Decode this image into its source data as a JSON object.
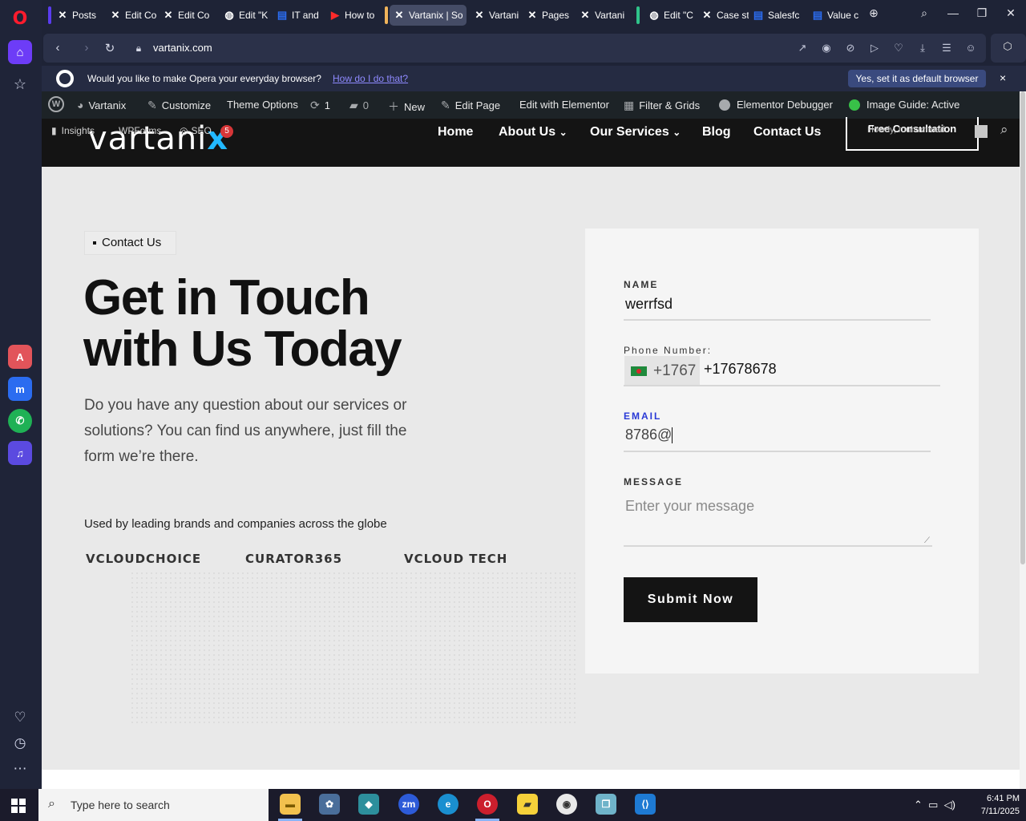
{
  "browser": {
    "url": "vartanix.com",
    "tabs": [
      {
        "label": "Posts",
        "icon": "x-logo"
      },
      {
        "label": "Edit Co",
        "icon": "x-logo"
      },
      {
        "label": "Edit Co",
        "icon": "x-logo"
      },
      {
        "label": "Edit \"K",
        "icon": "globe"
      },
      {
        "label": "IT and",
        "icon": "doc"
      },
      {
        "label": "How to",
        "icon": "youtube"
      },
      {
        "label": "Vartanix | So",
        "icon": "x-logo"
      },
      {
        "label": "Vartani",
        "icon": "x-logo"
      },
      {
        "label": "Pages",
        "icon": "x-logo"
      },
      {
        "label": "Vartani",
        "icon": "x-logo"
      },
      {
        "label": "Edit \"C",
        "icon": "globe"
      },
      {
        "label": "Case st",
        "icon": "x-logo"
      },
      {
        "label": "Salesfc",
        "icon": "doc"
      },
      {
        "label": "Value c",
        "icon": "doc"
      }
    ],
    "default_prompt": {
      "question": "Would you like to make Opera your everyday browser?",
      "link": "How do I do that?",
      "button": "Yes, set it as default browser",
      "close": "×"
    }
  },
  "wp_admin_bar": {
    "site": "Vartanix",
    "customize": "Customize",
    "theme_options": "Theme Options",
    "updates": "1",
    "comments": "0",
    "new": "New",
    "edit_page": "Edit Page",
    "edit_elementor": "Edit with Elementor",
    "filter_grids": "Filter & Grids",
    "elementor_debugger": "Elementor Debugger",
    "image_guide": "Image Guide: Active",
    "insights": "Insights",
    "wpforms": "WPForms",
    "seo": "SEO",
    "seo_badge": "5",
    "howdy": "Howdy, muhammad"
  },
  "site": {
    "logo_text": "vartani",
    "logo_x": "x",
    "nav": [
      "Home",
      "About Us",
      "Our Services",
      "Blog",
      "Contact Us"
    ],
    "cta": "Free Consultation"
  },
  "hero": {
    "pill": "Contact Us",
    "headline_1": "Get in Touch",
    "headline_2": "with Us Today",
    "paragraph": "Do you have any question about our services or solutions? You can find us anywhere, just fill the form we’re there.",
    "brands_caption": "Used by leading brands and companies across the globe",
    "brand_logos": [
      "VCLOUDCHOICE",
      "CURATOR365",
      "VCLOUD TECH"
    ]
  },
  "form": {
    "name_label": "NAME",
    "name_value": "werrfsd",
    "phone_label": "Phone Number:",
    "phone_cc": "+1767",
    "phone_value": "+17678678",
    "email_label": "EMAIL",
    "email_value": "8786@",
    "message_label": "MESSAGE",
    "message_placeholder": "Enter your message",
    "submit": "Submit Now"
  },
  "taskbar": {
    "search_placeholder": "Type here to search",
    "time": "6:41 PM",
    "date": "7/11/2025"
  },
  "colors": {
    "accent_opera": "#ff1b2d",
    "sidebar_home": "#6d3cf7",
    "email_focus": "#2a3ad6",
    "logo_x": "#22b8ff"
  }
}
